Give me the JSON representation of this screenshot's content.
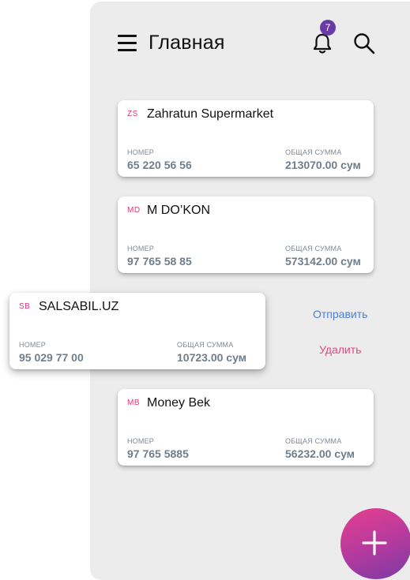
{
  "header": {
    "title": "Главная",
    "notification_count": "7",
    "menu_icon": "hamburger-menu-icon",
    "bell_icon": "bell-icon",
    "search_icon": "search-icon"
  },
  "labels": {
    "number": "НОМЕР",
    "total": "ОБЩАЯ СУММА"
  },
  "cards": [
    {
      "initials": "ZS",
      "name": "Zahratun Supermarket",
      "number": "65 220 56 56",
      "total": "213070.00 сум"
    },
    {
      "initials": "MD",
      "name": "M DO’KON",
      "number": "97 765 58 85",
      "total": "573142.00 сум"
    },
    {
      "initials": "SB",
      "name": "SALSABIL.UZ",
      "number": "95 029 77 00",
      "total": "10723.00 сум"
    },
    {
      "initials": "MB",
      "name": "Money Bek",
      "number": "97 765 5885",
      "total": "56232.00 сум"
    }
  ],
  "swipe_actions": {
    "send": "Отправить",
    "delete": "Удалить"
  },
  "colors": {
    "accent_pink": "#e0367a",
    "send_blue": "#4a7fd6",
    "delete_pink": "#e8457a",
    "badge_purple": "#6b3aa6"
  },
  "fab": {
    "icon": "plus-icon"
  }
}
